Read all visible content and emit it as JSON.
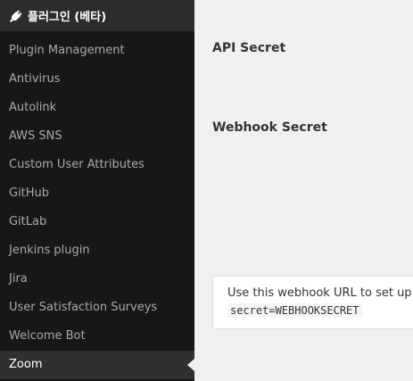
{
  "sidebar": {
    "header_title": "플러그인 (베타)",
    "header_icon": "plug-icon",
    "items": [
      {
        "label": "Plugin Management"
      },
      {
        "label": "Antivirus"
      },
      {
        "label": "Autolink"
      },
      {
        "label": "AWS SNS"
      },
      {
        "label": "Custom User Attributes"
      },
      {
        "label": "GitHub"
      },
      {
        "label": "GitLab"
      },
      {
        "label": "Jenkins plugin"
      },
      {
        "label": "Jira"
      },
      {
        "label": "User Satisfaction Surveys"
      },
      {
        "label": "Welcome Bot"
      },
      {
        "label": "Zoom",
        "active": true
      }
    ]
  },
  "main": {
    "api_secret_label": "API Secret",
    "webhook_secret_label": "Webhook Secret",
    "info_text": "Use this webhook URL to set up th",
    "info_code": "secret=WEBHOOKSECRET"
  },
  "colors": {
    "sidebar_bg": "#171717",
    "sidebar_header_bg": "#2c2c2c",
    "active_item_bg": "#303030",
    "main_bg": "#f0f0f0"
  }
}
